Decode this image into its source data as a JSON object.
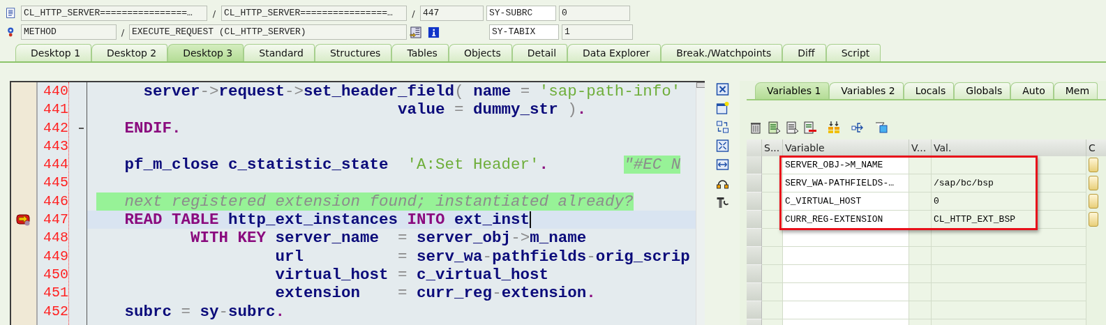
{
  "header": {
    "program": "CL_HTTP_SERVER================…",
    "include": "CL_HTTP_SERVER================…",
    "line": "447",
    "event_type": "METHOD",
    "event": "EXECUTE_REQUEST (CL_HTTP_SERVER)",
    "separators": [
      "/",
      "/",
      "/"
    ],
    "system_fields": [
      {
        "name": "SY-SUBRC",
        "value": "0"
      },
      {
        "name": "SY-TABIX",
        "value": "1"
      }
    ]
  },
  "tabs": [
    {
      "label": "Desktop 1",
      "selected": false
    },
    {
      "label": "Desktop 2",
      "selected": false
    },
    {
      "label": "Desktop 3",
      "selected": true
    },
    {
      "label": "Standard",
      "selected": false
    },
    {
      "label": "Structures",
      "selected": false
    },
    {
      "label": "Tables",
      "selected": false
    },
    {
      "label": "Objects",
      "selected": false
    },
    {
      "label": "Detail",
      "selected": false
    },
    {
      "label": "Data Explorer",
      "selected": false
    },
    {
      "label": "Break./Watchpoints",
      "selected": false
    },
    {
      "label": "Diff",
      "selected": false
    },
    {
      "label": "Script",
      "selected": false
    }
  ],
  "editor": {
    "lines": [
      {
        "number": "440",
        "current": false,
        "tokens": [
          {
            "kind": "name",
            "text": "     server"
          },
          {
            "kind": "operator",
            "text": "->"
          },
          {
            "kind": "name",
            "text": "request"
          },
          {
            "kind": "operator",
            "text": "->"
          },
          {
            "kind": "name",
            "text": "set_header_field"
          },
          {
            "kind": "operator",
            "text": "( "
          },
          {
            "kind": "name",
            "text": "name "
          },
          {
            "kind": "operator",
            "text": "= "
          },
          {
            "kind": "string",
            "text": "'sap-path-info'"
          }
        ]
      },
      {
        "number": "441",
        "current": false,
        "tokens": [
          {
            "kind": "name",
            "text": "                                value "
          },
          {
            "kind": "operator",
            "text": "= "
          },
          {
            "kind": "name",
            "text": "dummy_str "
          },
          {
            "kind": "operator",
            "text": ")"
          },
          {
            "kind": "keyword",
            "text": "."
          }
        ]
      },
      {
        "number": "442",
        "current": false,
        "fold": true,
        "tokens": [
          {
            "kind": "keyword",
            "text": "   ENDIF."
          }
        ]
      },
      {
        "number": "443",
        "current": false
      },
      {
        "number": "444",
        "current": false,
        "tokens": [
          {
            "kind": "name",
            "text": "   pf_m_close c_statistic_state  "
          },
          {
            "kind": "string",
            "text": "'A:Set Header'"
          },
          {
            "kind": "keyword",
            "text": ".        "
          },
          {
            "kind": "pragma",
            "text": "\"#EC N"
          }
        ]
      },
      {
        "number": "445",
        "current": false
      },
      {
        "number": "446",
        "current": false,
        "tokens": [
          {
            "kind": "comment",
            "text": "   next registered extension found; instantiated already?"
          }
        ]
      },
      {
        "number": "447",
        "current": true,
        "tokens": [
          {
            "kind": "keyword",
            "text": "   READ TABLE "
          },
          {
            "kind": "name",
            "text": "http_ext_instances "
          },
          {
            "kind": "keyword",
            "text": "INTO "
          },
          {
            "kind": "name",
            "text": "ext_inst"
          }
        ]
      },
      {
        "number": "448",
        "current": false,
        "tokens": [
          {
            "kind": "keyword",
            "text": "          WITH KEY "
          },
          {
            "kind": "name",
            "text": "server_name  "
          },
          {
            "kind": "operator",
            "text": "= "
          },
          {
            "kind": "name",
            "text": "server_obj"
          },
          {
            "kind": "operator",
            "text": "->"
          },
          {
            "kind": "name",
            "text": "m_name"
          }
        ]
      },
      {
        "number": "449",
        "current": false,
        "tokens": [
          {
            "kind": "name",
            "text": "                   url          "
          },
          {
            "kind": "operator",
            "text": "= "
          },
          {
            "kind": "name",
            "text": "serv_wa"
          },
          {
            "kind": "operator",
            "text": "-"
          },
          {
            "kind": "name",
            "text": "pathfields"
          },
          {
            "kind": "operator",
            "text": "-"
          },
          {
            "kind": "name",
            "text": "orig_scrip"
          }
        ]
      },
      {
        "number": "450",
        "current": false,
        "tokens": [
          {
            "kind": "name",
            "text": "                   virtual_host "
          },
          {
            "kind": "operator",
            "text": "= "
          },
          {
            "kind": "name",
            "text": "c_virtual_host"
          }
        ]
      },
      {
        "number": "451",
        "current": false,
        "tokens": [
          {
            "kind": "name",
            "text": "                   extension    "
          },
          {
            "kind": "operator",
            "text": "= "
          },
          {
            "kind": "name",
            "text": "curr_reg"
          },
          {
            "kind": "operator",
            "text": "-"
          },
          {
            "kind": "name",
            "text": "extension"
          },
          {
            "kind": "keyword",
            "text": "."
          }
        ]
      },
      {
        "number": "452",
        "current": false,
        "tokens": [
          {
            "kind": "name",
            "text": "   subrc "
          },
          {
            "kind": "operator",
            "text": "= "
          },
          {
            "kind": "name",
            "text": "sy"
          },
          {
            "kind": "operator",
            "text": "-"
          },
          {
            "kind": "name",
            "text": "subrc"
          },
          {
            "kind": "keyword",
            "text": "."
          }
        ]
      }
    ]
  },
  "variables": {
    "tabs": [
      {
        "label": "Variables 1",
        "selected": true
      },
      {
        "label": "Variables 2",
        "selected": false
      },
      {
        "label": "Locals",
        "selected": false
      },
      {
        "label": "Globals",
        "selected": false
      },
      {
        "label": "Auto",
        "selected": false
      },
      {
        "label": "Mem",
        "selected": false
      }
    ],
    "columns": [
      "S...",
      "Variable",
      "V...",
      "Val.",
      "C"
    ],
    "framed": true,
    "rows": [
      {
        "variable": "SERVER_OBJ->M_NAME"
      },
      {
        "variable": "SERV_WA-PATHFIELDS-…",
        "value": "/sap/bc/bsp"
      },
      {
        "variable": "C_VIRTUAL_HOST",
        "value": "0"
      },
      {
        "variable": "CURR_REG-EXTENSION",
        "value": "CL_HTTP_EXT_BSP"
      }
    ]
  }
}
